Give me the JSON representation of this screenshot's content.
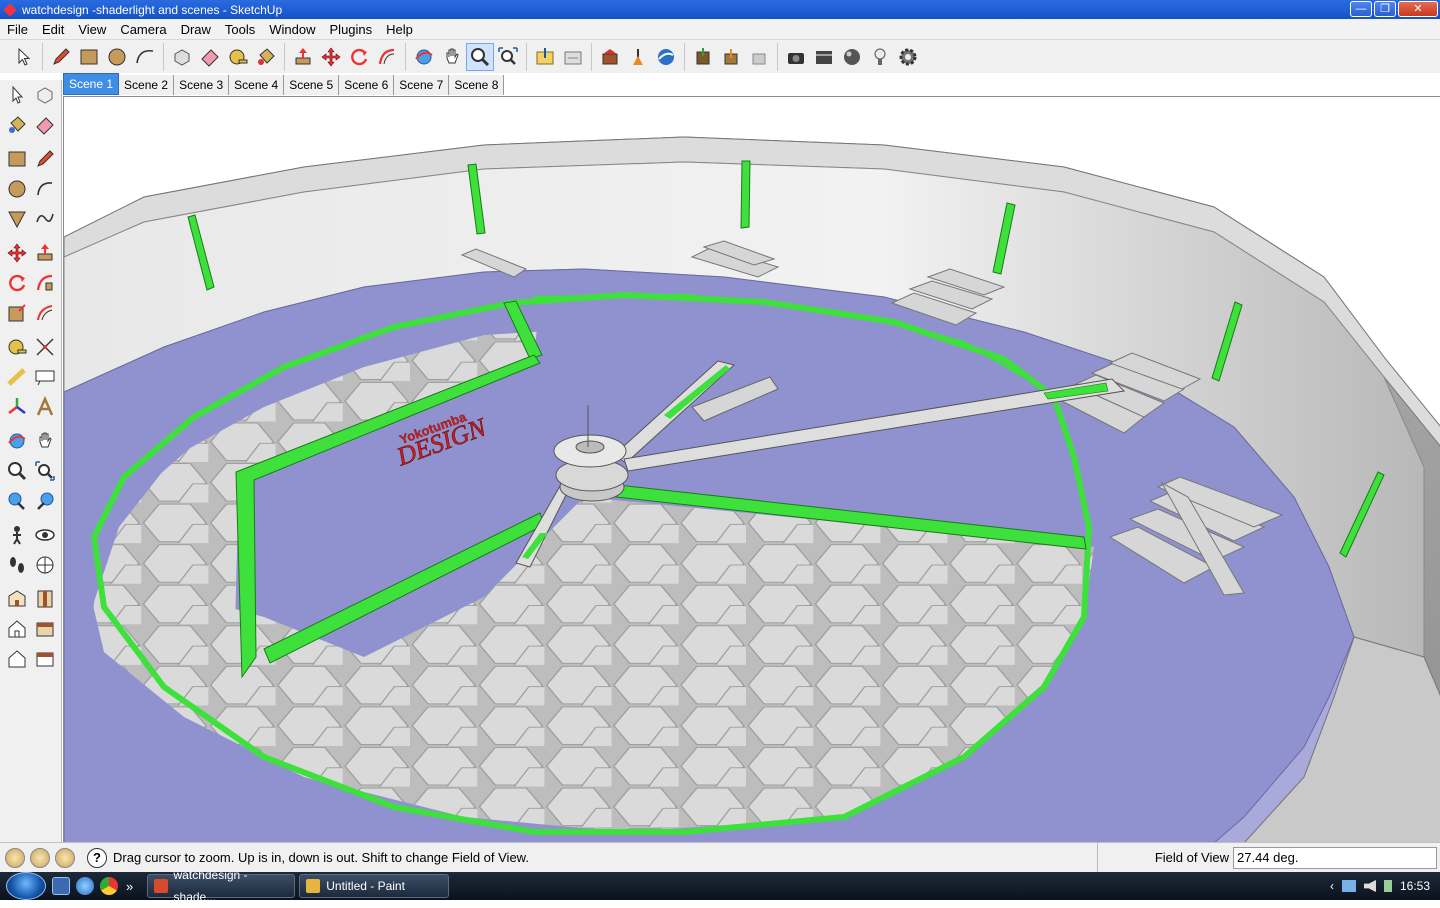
{
  "window": {
    "title": "watchdesign -shaderlight and scenes - SketchUp",
    "buttons": {
      "minimize": "—",
      "maximize": "❐",
      "close": "✕"
    }
  },
  "menu": [
    "File",
    "Edit",
    "View",
    "Camera",
    "Draw",
    "Tools",
    "Window",
    "Plugins",
    "Help"
  ],
  "toolbar": {
    "groups": [
      [
        "select-icon"
      ],
      [
        "pencil-icon",
        "rectangle-icon",
        "circle-icon",
        "arc-icon"
      ],
      [
        "make-component-icon",
        "eraser-icon",
        "tape-measure-icon",
        "paint-bucket-icon"
      ],
      [
        "push-pull-icon",
        "move-icon",
        "rotate-icon",
        "follow-me-icon"
      ],
      [
        "orbit-icon",
        "pan-icon",
        "zoom-icon",
        "zoom-extents-icon"
      ],
      [
        "import-icon",
        "export-icon"
      ],
      [
        "add-location-icon",
        "toggle-terrain-icon",
        "preview-google-earth-icon"
      ],
      [
        "get-models-icon",
        "share-model-icon",
        "share-component-icon"
      ],
      [
        "shaderlight-camera-icon",
        "shaderlight-animation-icon",
        "shaderlight-material-icon",
        "shaderlight-light-icon",
        "shaderlight-settings-icon"
      ]
    ]
  },
  "scenes": [
    "Scene 1",
    "Scene 2",
    "Scene 3",
    "Scene 4",
    "Scene 5",
    "Scene 6",
    "Scene 7",
    "Scene 8"
  ],
  "active_scene": "Scene 1",
  "model": {
    "logo_line1": "Yokotumba",
    "logo_line2": "DESIGN"
  },
  "status": {
    "text": "Drag cursor to zoom.  Up is in, down is out. Shift to change Field of View.",
    "help_glyph": "?",
    "measure_label": "Field of View",
    "measure_value": "27.44 deg."
  },
  "taskbar": {
    "tasks": [
      {
        "label": "watchdesign -shade...",
        "color": "#d84a2e"
      },
      {
        "label": "Untitled - Paint",
        "color": "#e8b440"
      }
    ],
    "chevron": "»",
    "tray_arrow": "‹",
    "clock": "16:53"
  },
  "colors": {
    "dial": "#8f92cf",
    "accent_green": "#3ee03c",
    "hex_gray": "#d4d4d4",
    "logo_red": "#c82020"
  }
}
